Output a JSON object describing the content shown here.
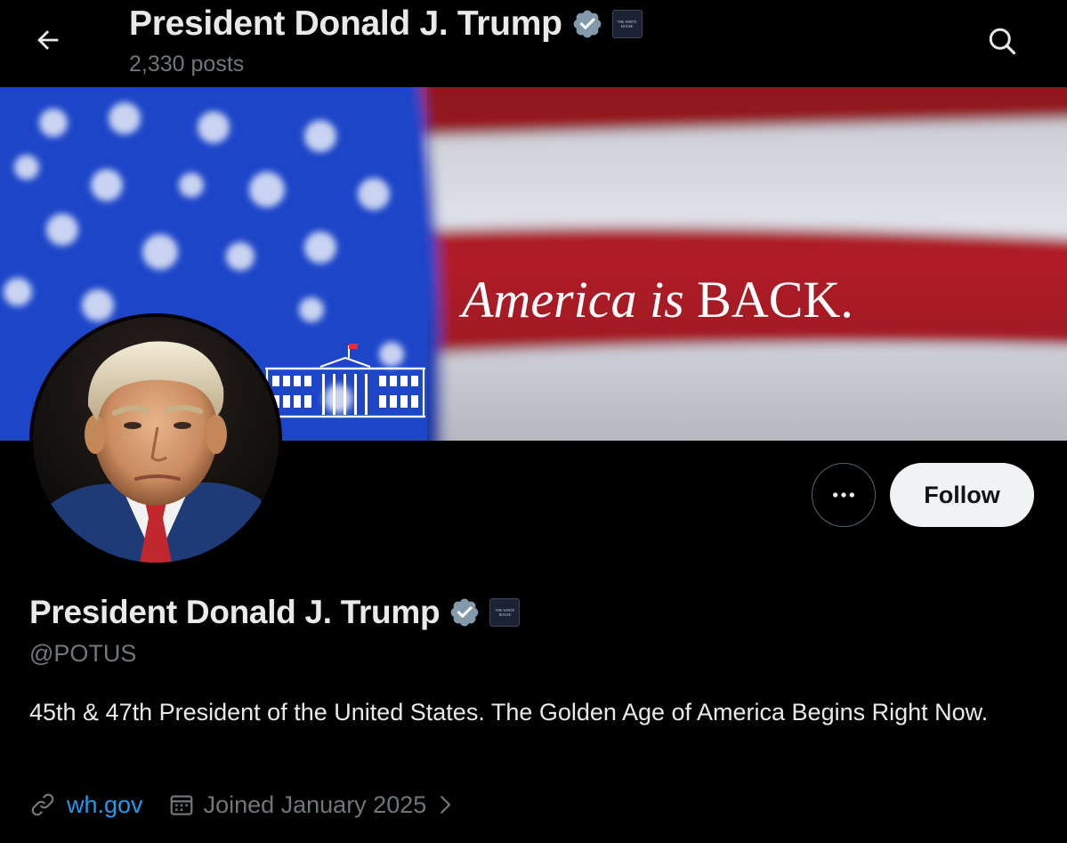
{
  "header": {
    "name": "President Donald J. Trump",
    "posts_count": "2,330 posts",
    "back_icon": "arrow-left-icon",
    "search_icon": "search-icon"
  },
  "banner": {
    "slogan_italic": "America is",
    "slogan_caps": "BACK.",
    "logo_icon": "white-house-logo",
    "background": "american-flag"
  },
  "profile": {
    "name": "President Donald J. Trump",
    "handle": "@POTUS",
    "bio": "45th & 47th President of the United States. The Golden Age of America Begins Right Now.",
    "website": "wh.gov",
    "joined": "Joined January 2025",
    "verified_badge": "verified-badge-gray",
    "affiliation_badge": "white-house-affiliation-badge",
    "affiliation_text": "THE WHITE HOUSE"
  },
  "actions": {
    "more_icon": "more-options-icon",
    "follow_label": "Follow"
  },
  "colors": {
    "background": "#000000",
    "text_primary": "#e7e9ea",
    "text_secondary": "#71767b",
    "link": "#1d9bf0",
    "verified_gray": "#829aab",
    "follow_bg": "#eff3f4",
    "flag_red": "#b01e28",
    "flag_blue": "#1e44c8"
  }
}
